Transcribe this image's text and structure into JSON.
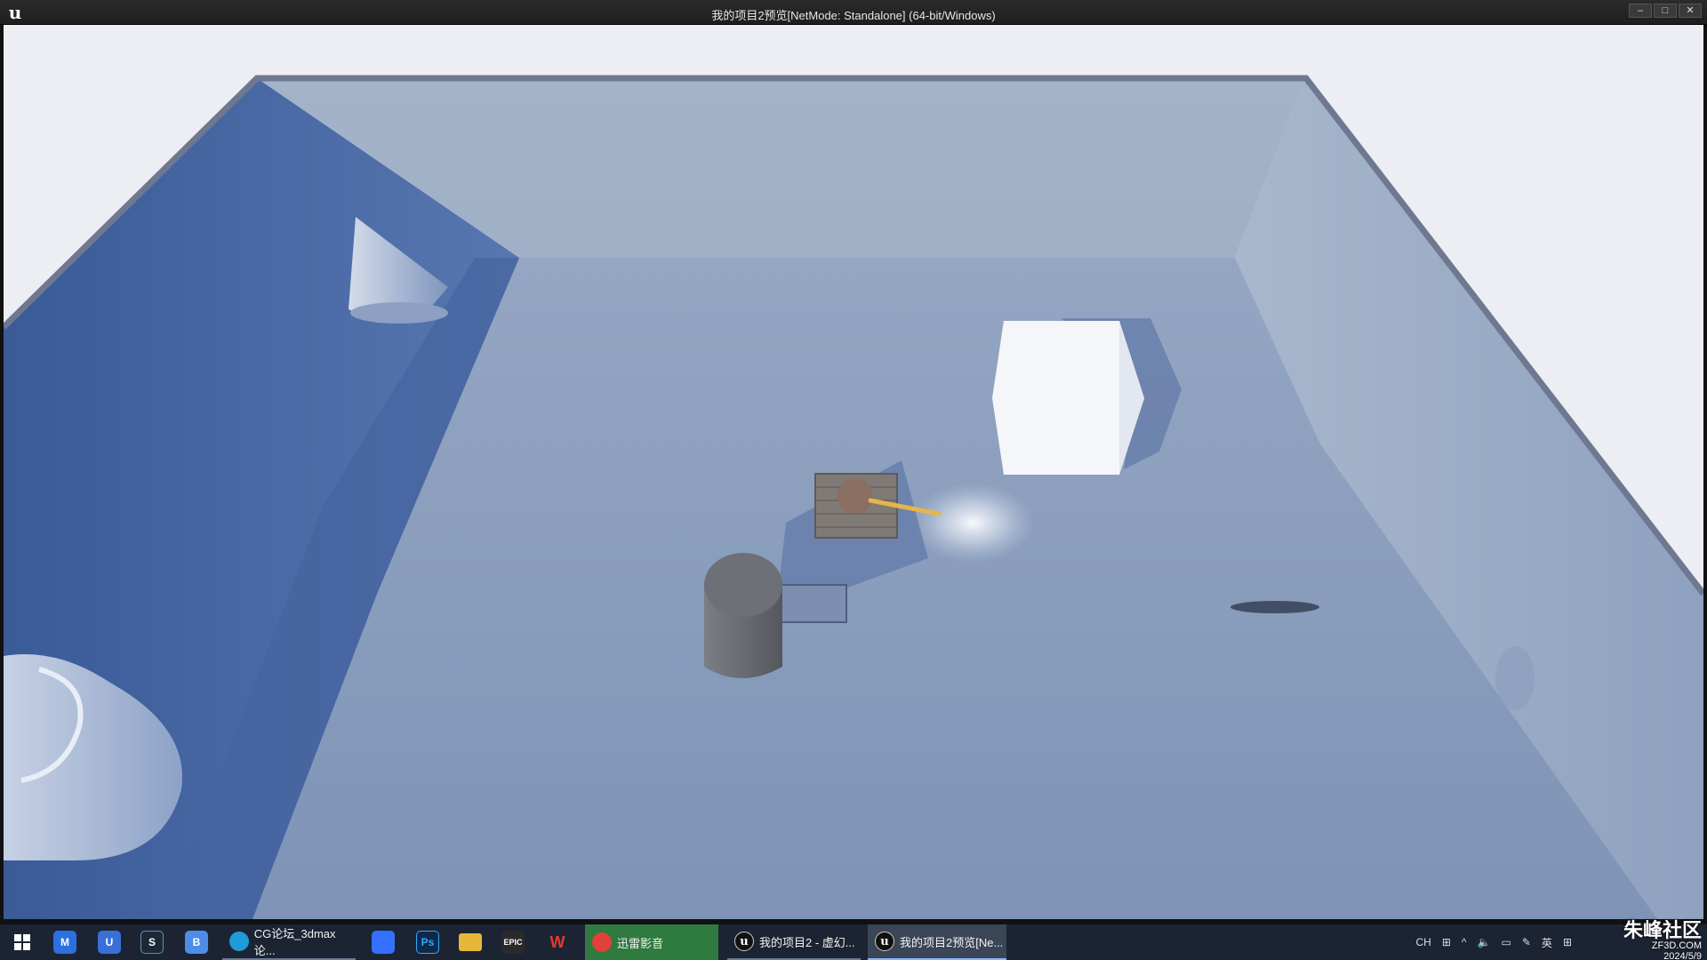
{
  "window": {
    "title": "我的项目2预览[NetMode: Standalone] (64-bit/Windows)",
    "logo_icon": "unreal-logo-icon",
    "minimize": "–",
    "maximize": "□",
    "close": "✕"
  },
  "colors": {
    "sky": "#eceef3",
    "floor": "#8799b8",
    "wall_back": "#a5b4c9",
    "wall_left": "#4a6aa6",
    "wall_right": "#9aabc4",
    "shadow": "#3f5f9e",
    "cube": "#f4f5f8",
    "taskbar": "#1c2433"
  },
  "scene": {
    "objects": [
      "cone",
      "cylinder-left",
      "white-cube",
      "tank-character",
      "dark-cylinder",
      "metal-slab",
      "spotlight",
      "floor-decal"
    ]
  },
  "taskbar": {
    "start_icon": "windows-start-icon",
    "pinned": [
      {
        "icon": "maxthon-icon",
        "label": "M",
        "color": "#2b6fe0"
      },
      {
        "icon": "unity-hub-icon",
        "label": "U",
        "color": "#3a6fd8"
      },
      {
        "icon": "steam-icon",
        "label": "S",
        "color": "#1b2838"
      },
      {
        "icon": "baidu-netdisk-icon",
        "label": "B",
        "color": "#4d8de8"
      }
    ],
    "apps": [
      {
        "icon": "edge-icon",
        "label": "CG论坛_3dmax论..."
      },
      {
        "icon": "feishu-icon",
        "label": ""
      },
      {
        "icon": "photoshop-icon",
        "label": "Ps"
      },
      {
        "icon": "file-explorer-icon",
        "label": ""
      },
      {
        "icon": "epic-games-icon",
        "label": "EPIC"
      },
      {
        "icon": "wps-icon",
        "label": "W"
      },
      {
        "icon": "xunlei-player-icon",
        "label": "迅雷影音"
      },
      {
        "icon": "unreal-editor-icon",
        "label": "我的项目2 - 虚幻..."
      },
      {
        "icon": "unreal-preview-icon",
        "label": "我的项目2预览[Ne..."
      }
    ],
    "tray": {
      "lang": "CH",
      "ime": "英",
      "chevron": "^",
      "volume_icon": "volume-icon",
      "network_icon": "network-icon"
    }
  },
  "watermark": {
    "main": "朱峰社区",
    "sub": "ZF3D.COM",
    "date": "2024/5/9"
  }
}
